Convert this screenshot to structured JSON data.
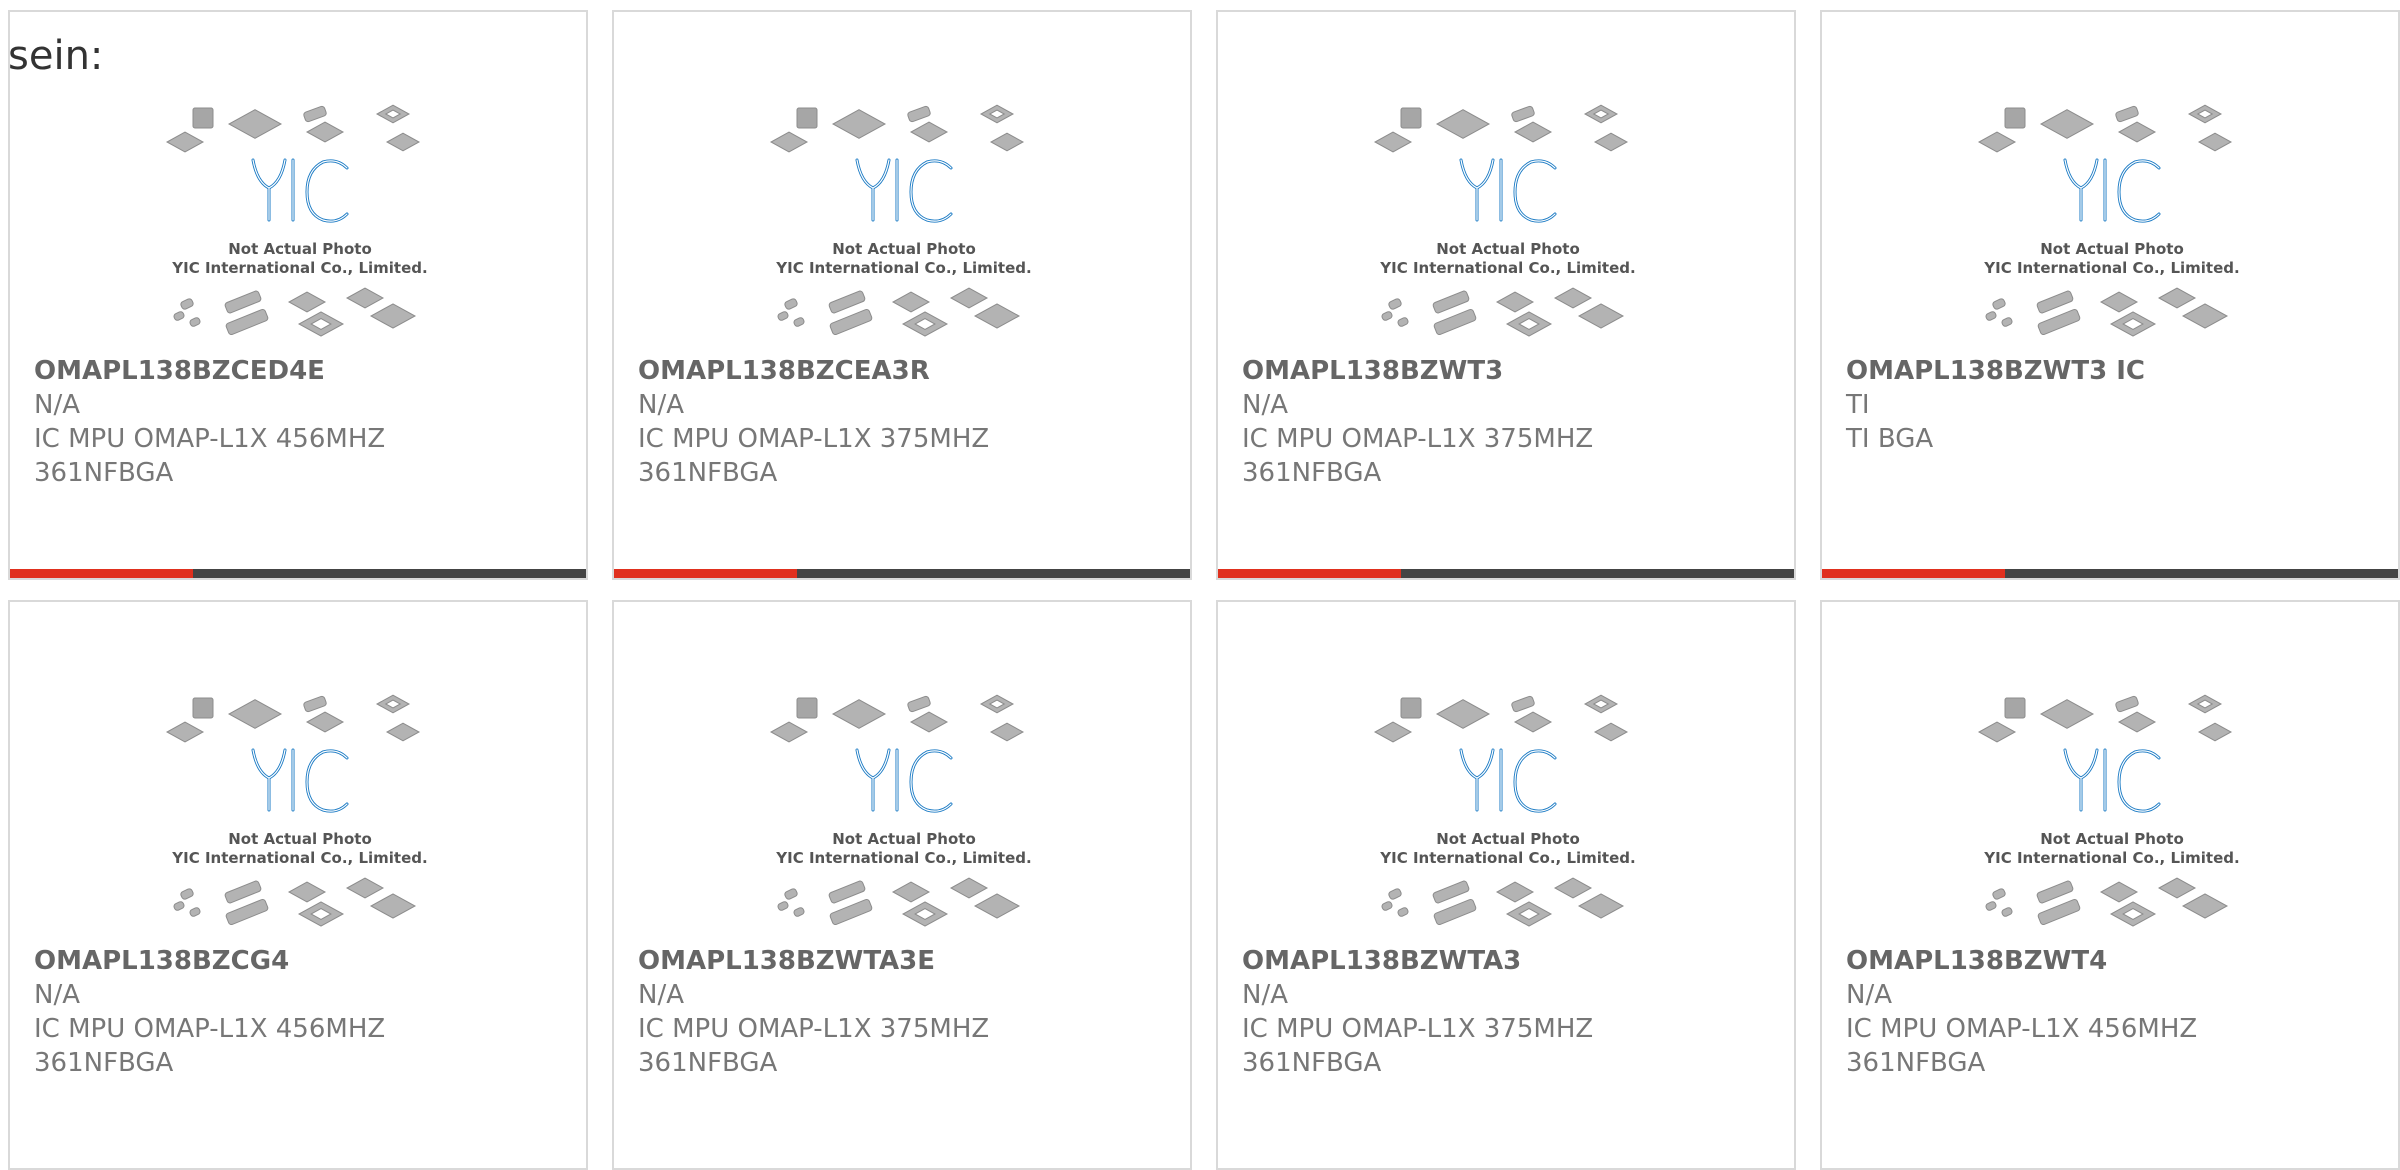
{
  "intro_text": "sein:",
  "colors": {
    "accent_red": "#e0301e",
    "accent_dark": "#444444",
    "logo_blue": "#1a7ac4",
    "card_border": "#d9d9d9"
  },
  "placeholder": {
    "logo_letters": "YIC",
    "caption_line1": "Not Actual Photo",
    "caption_line2": "YIC International Co., Limited."
  },
  "products": [
    {
      "part_number": "OMAPL138BZCED4E",
      "manufacturer": "N/A",
      "description": "IC MPU OMAP-L1X 456MHZ 361NFBGA",
      "desc_line1": "IC MPU OMAP-L1X 456MHZ",
      "desc_line2": "361NFBGA",
      "has_accent_bar": true
    },
    {
      "part_number": "OMAPL138BZCEA3R",
      "manufacturer": "N/A",
      "description": "IC MPU OMAP-L1X 375MHZ 361NFBGA",
      "desc_line1": "IC MPU OMAP-L1X 375MHZ",
      "desc_line2": "361NFBGA",
      "has_accent_bar": true
    },
    {
      "part_number": "OMAPL138BZWT3",
      "manufacturer": "N/A",
      "description": "IC MPU OMAP-L1X 375MHZ 361NFBGA",
      "desc_line1": "IC MPU OMAP-L1X 375MHZ",
      "desc_line2": "361NFBGA",
      "has_accent_bar": true
    },
    {
      "part_number": "OMAPL138BZWT3 IC",
      "manufacturer": "TI",
      "description": "TI BGA",
      "desc_line1": "TI BGA",
      "desc_line2": "",
      "has_accent_bar": true
    },
    {
      "part_number": "OMAPL138BZCG4",
      "manufacturer": "N/A",
      "description": "IC MPU OMAP-L1X 456MHZ 361NFBGA",
      "desc_line1": "IC MPU OMAP-L1X 456MHZ",
      "desc_line2": "361NFBGA",
      "has_accent_bar": false
    },
    {
      "part_number": "OMAPL138BZWTA3E",
      "manufacturer": "N/A",
      "description": "IC MPU OMAP-L1X 375MHZ 361NFBGA",
      "desc_line1": "IC MPU OMAP-L1X 375MHZ",
      "desc_line2": "361NFBGA",
      "has_accent_bar": false
    },
    {
      "part_number": "OMAPL138BZWTA3",
      "manufacturer": "N/A",
      "description": "IC MPU OMAP-L1X 375MHZ 361NFBGA",
      "desc_line1": "IC MPU OMAP-L1X 375MHZ",
      "desc_line2": "361NFBGA",
      "has_accent_bar": false
    },
    {
      "part_number": "OMAPL138BZWT4",
      "manufacturer": "N/A",
      "description": "IC MPU OMAP-L1X 456MHZ 361NFBGA",
      "desc_line1": "IC MPU OMAP-L1X 456MHZ",
      "desc_line2": "361NFBGA",
      "has_accent_bar": false
    }
  ]
}
